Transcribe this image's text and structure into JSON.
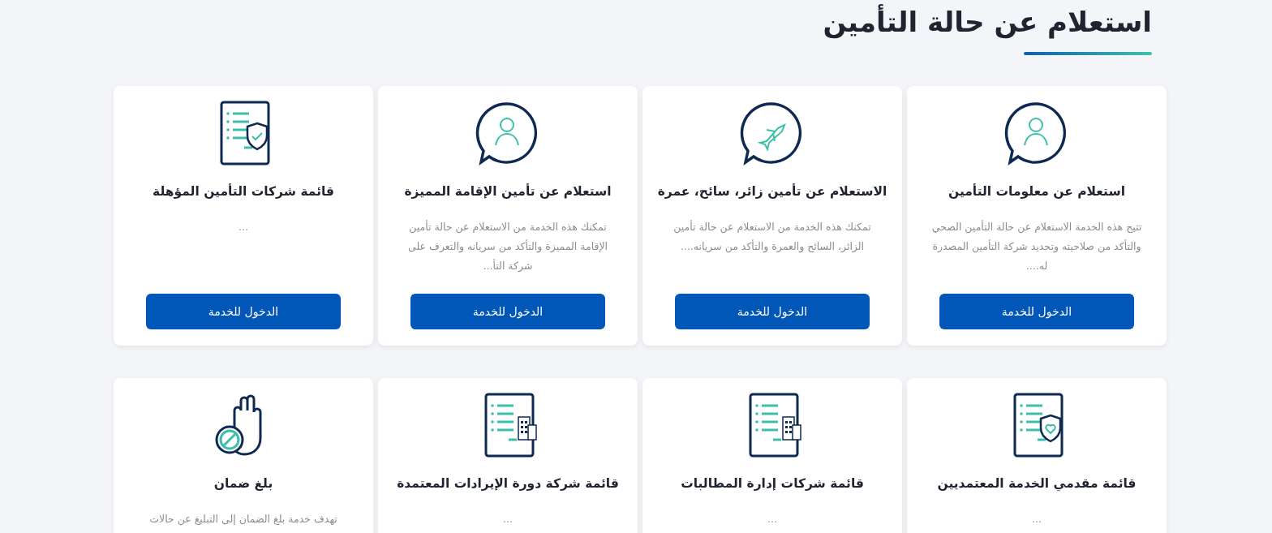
{
  "heading": "استعلام عن حالة التأمين",
  "cards": [
    {
      "kind": "person-bubble",
      "title": "استعلام عن معلومات التأمين",
      "description": "تتيح هذه الخدمة الاستعلام عن حالة التأمين الصحي والتأكد من صلاحيته وتحديد شركة التأمين المصدرة له....",
      "button": "الدخول للخدمة"
    },
    {
      "kind": "plane-bubble",
      "title": "الاستعلام عن تأمين زائر، سائح، عمرة",
      "description": "تمكنك هذه الخدمة من الاستعلام عن حالة تأمين الزائر، السائح والعمرة والتأكد من سريانه....",
      "button": "الدخول للخدمة"
    },
    {
      "kind": "person-bubble",
      "title": "استعلام عن تأمين الإقامة المميزة",
      "description": "تمكنك هذه الخدمة من الاستعلام عن حالة تأمين الإقامة المميزة والتأكد من سريانه والتعرف على شركة التأ...",
      "button": "الدخول للخدمة"
    },
    {
      "kind": "document-shield",
      "title": "قائمة شركات التأمين المؤهلة",
      "description": "...",
      "button": "الدخول للخدمة"
    },
    {
      "kind": "document-shield-heart",
      "title": "قائمة مقدمي الخدمة المعتمديين",
      "description": "..."
    },
    {
      "kind": "document-building",
      "title": "قائمة شركات إدارة المطالبات",
      "description": "..."
    },
    {
      "kind": "document-building",
      "title": "قائمة شركة دورة الإيرادات المعتمدة",
      "description": "..."
    },
    {
      "kind": "hand-stop",
      "title": "بلغ ضمان",
      "description": "تهدف خدمة بلغ الضمان إلى التبليغ عن حالات"
    }
  ]
}
